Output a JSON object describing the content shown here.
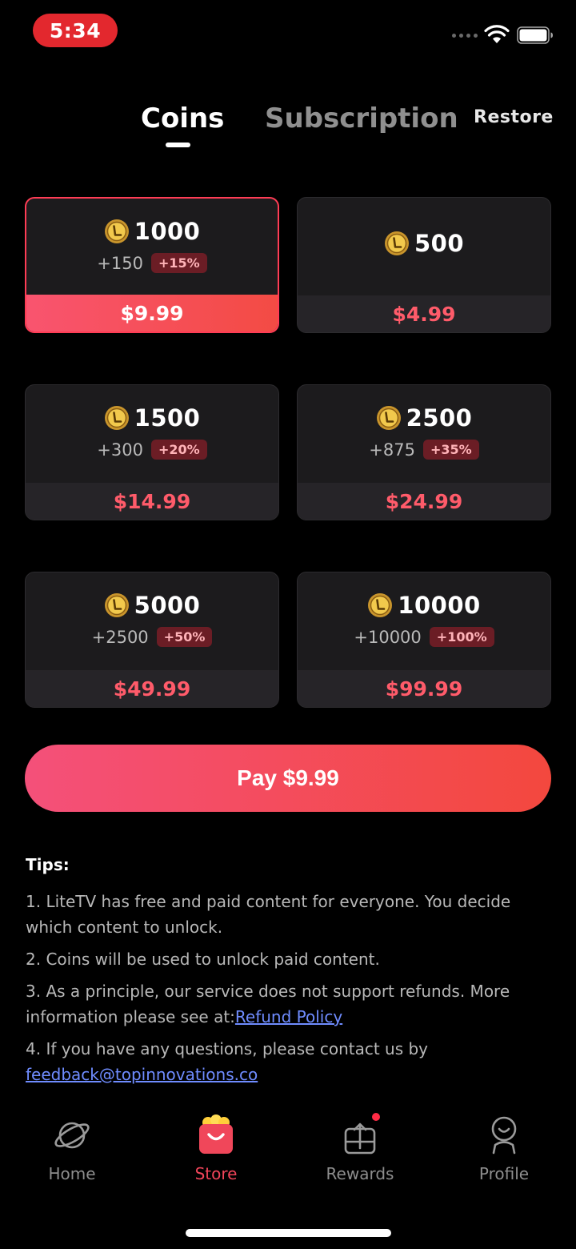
{
  "status_bar": {
    "time": "5:34"
  },
  "header": {
    "tabs": [
      {
        "label": "Coins",
        "active": true
      },
      {
        "label": "Subscription",
        "active": false
      }
    ],
    "restore_label": "Restore"
  },
  "packages": [
    {
      "coins": "1000",
      "bonus": "+150",
      "badge": "+15%",
      "price": "$9.99",
      "selected": true
    },
    {
      "coins": "500",
      "bonus": "",
      "badge": "",
      "price": "$4.99",
      "selected": false
    },
    {
      "coins": "1500",
      "bonus": "+300",
      "badge": "+20%",
      "price": "$14.99",
      "selected": false
    },
    {
      "coins": "2500",
      "bonus": "+875",
      "badge": "+35%",
      "price": "$24.99",
      "selected": false
    },
    {
      "coins": "5000",
      "bonus": "+2500",
      "badge": "+50%",
      "price": "$49.99",
      "selected": false
    },
    {
      "coins": "10000",
      "bonus": "+10000",
      "badge": "+100%",
      "price": "$99.99",
      "selected": false
    }
  ],
  "pay_button": {
    "label": "Pay $9.99"
  },
  "tips": {
    "title": "Tips:",
    "items": [
      "1. LiteTV has free and paid content for everyone. You decide which content to unlock.",
      "2. Coins will be used to unlock paid content.",
      "3. As a principle, our service does not support refunds. More information please see at:",
      "4. If you have any questions, please contact us by"
    ],
    "refund_link": "Refund Policy",
    "email_link": "feedback@topinnovations.co"
  },
  "nav": [
    {
      "label": "Home",
      "icon": "planet-icon",
      "active": false
    },
    {
      "label": "Store",
      "icon": "shopping-bag-icon",
      "active": true
    },
    {
      "label": "Rewards",
      "icon": "gift-icon",
      "active": false,
      "notification_dot": true
    },
    {
      "label": "Profile",
      "icon": "person-icon",
      "active": false
    }
  ],
  "colors": {
    "accent": "#f04459",
    "gradient_start": "#f4507a",
    "gradient_end": "#f3483e",
    "background": "#000000",
    "card": "#1c1b1d",
    "price_text": "#ff5b6a"
  }
}
